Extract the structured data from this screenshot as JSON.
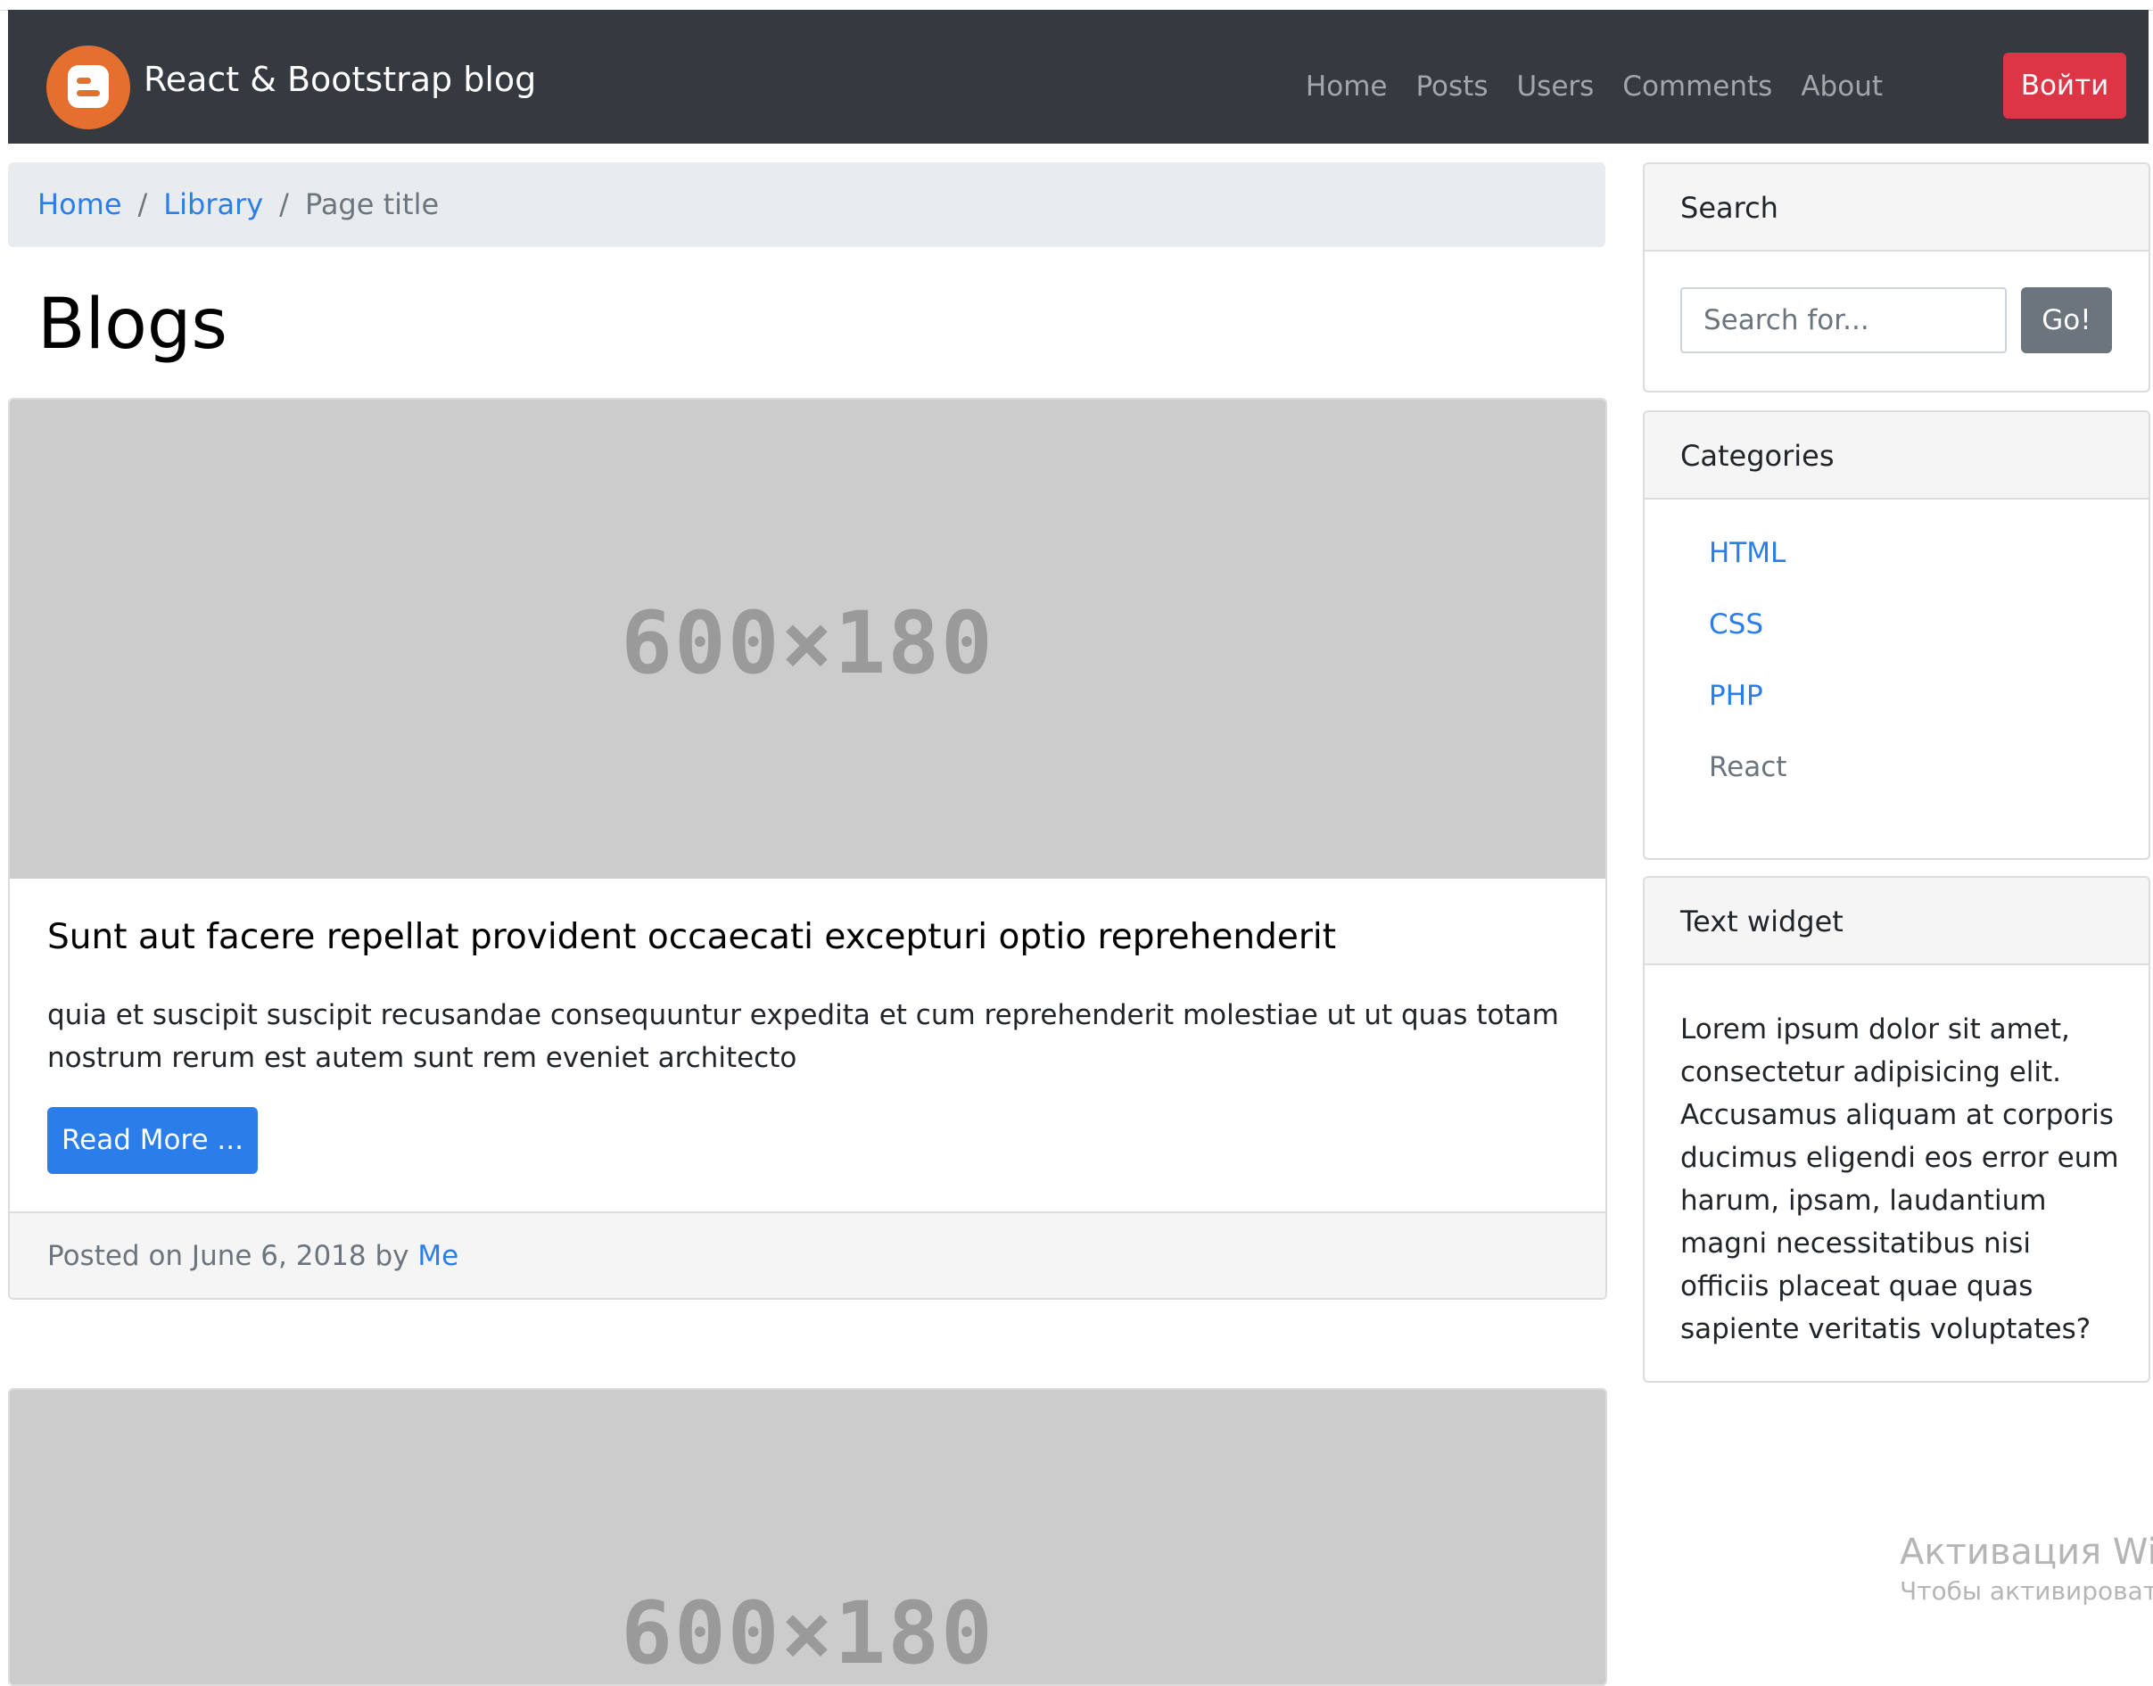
{
  "navbar": {
    "brand": "React & Bootstrap blog",
    "brand_icon": "blogger-icon",
    "links": [
      "Home",
      "Posts",
      "Users",
      "Comments",
      "About"
    ],
    "login_label": "Войти",
    "colors": {
      "background": "#343a40",
      "login": "#dc3545",
      "logo": "#e56f2e"
    }
  },
  "breadcrumb": {
    "items": [
      "Home",
      "Library"
    ],
    "separator": "/",
    "active": "Page title"
  },
  "main": {
    "title": "Blogs",
    "posts": [
      {
        "image_text": "600×180",
        "title": "Sunt aut facere repellat provident occaecati excepturi optio reprehenderit",
        "body": "quia et suscipit suscipit recusandae consequuntur expedita et cum reprehenderit molestiae ut ut quas totam nostrum rerum est autem sunt rem eveniet architecto",
        "read_more": "Read More ...",
        "footer_prefix": "Posted on June 6, 2018 by",
        "author": "Me"
      },
      {
        "image_text": "600×180"
      }
    ]
  },
  "sidebar": {
    "search": {
      "title": "Search",
      "placeholder": "Search for...",
      "button": "Go!"
    },
    "categories": {
      "title": "Categories",
      "items": [
        "HTML",
        "CSS",
        "PHP",
        "React"
      ]
    },
    "text_widget": {
      "title": "Text widget",
      "body": "Lorem ipsum dolor sit amet, consectetur adipisicing elit. Accusamus aliquam at corporis ducimus eligendi eos error eum harum, ipsam, laudantium magni necessitatibus nisi officiis placeat quae quas sapiente veritatis voluptates?"
    }
  },
  "watermark": {
    "line1": "Активация Winc",
    "line2": "Чтобы активировать"
  },
  "colors": {
    "link": "#2b7de9",
    "primary_button": "#2b7de9",
    "secondary_button": "#6c757d",
    "placeholder_bg": "#cccccc"
  }
}
